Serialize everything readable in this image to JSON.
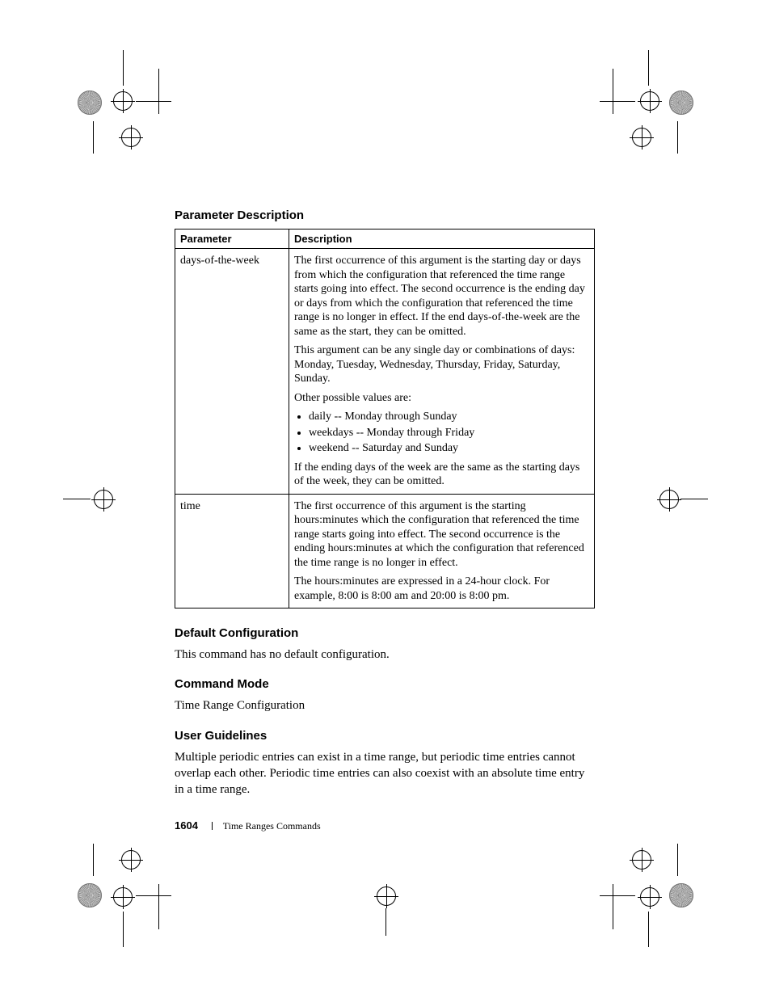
{
  "sections": {
    "param_desc_heading": "Parameter Description",
    "default_cfg_heading": "Default Configuration",
    "default_cfg_text": "This command has no default configuration.",
    "cmd_mode_heading": "Command Mode",
    "cmd_mode_text": "Time Range Configuration",
    "user_guidelines_heading": "User Guidelines",
    "user_guidelines_text": "Multiple periodic entries can exist in a time range, but periodic time entries cannot overlap each other. Periodic time entries can also coexist with an absolute time entry in a time range."
  },
  "table": {
    "headers": {
      "param": "Parameter",
      "desc": "Description"
    },
    "rows": [
      {
        "param": "days-of-the-week",
        "desc": {
          "p1": "The first occurrence of this argument is the starting day or days from which the configuration that referenced the time range starts going into effect. The second occurrence is the ending day or days from which the configuration that referenced the time range is no longer in effect. If the end days-of-the-week are the same as the start, they can be omitted.",
          "p2": "This argument can be any single day or combinations of days: Monday, Tuesday, Wednesday, Thursday, Friday, Saturday, Sunday.",
          "p3": "Other possible values are:",
          "bullets": [
            "daily -- Monday through Sunday",
            "weekdays -- Monday through Friday",
            "weekend -- Saturday and Sunday"
          ],
          "p4": "If the ending days of the week are the same as the starting days of the week, they can be omitted."
        }
      },
      {
        "param": "time",
        "desc": {
          "p1": "The first occurrence of this argument is the starting hours:minutes which the configuration that referenced the time range starts going into effect. The second occurrence is the ending hours:minutes at which the configuration that referenced the time range is no longer in effect.",
          "p2": "The hours:minutes are expressed in a 24-hour clock. For example, 8:00 is 8:00 am and 20:00 is 8:00 pm."
        }
      }
    ]
  },
  "footer": {
    "page_number": "1604",
    "section_title": "Time Ranges Commands"
  }
}
